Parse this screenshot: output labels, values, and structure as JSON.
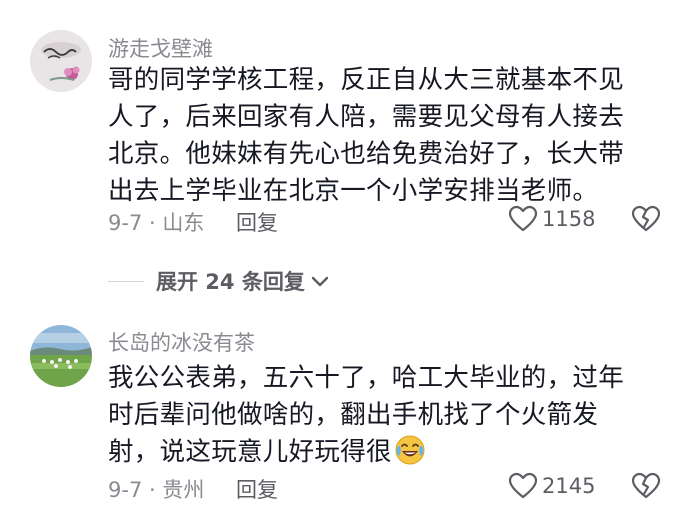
{
  "comments": [
    {
      "username": "游走戈壁滩",
      "lines": [
        "哥的同学学核工程，反正自从大三就基本不见",
        "人了，后来回家有人陪，需要见父母有人接去",
        "北京。他妹妹有先心也给免费治好了，长大带",
        "出去上学毕业在北京一个小学安排当老师。"
      ],
      "meta": "9-7 · 山东",
      "reply_label": "回复",
      "likes": "1158",
      "avatar_icon": "calligraphy-flower-avatar"
    },
    {
      "username": "长岛的冰没有茶",
      "lines": [
        "我公公表弟，五六十了，哈工大毕业的，过年",
        "时后辈问他做啥的，翻出手机找了个火箭发",
        "射，说这玩意儿好玩得很"
      ],
      "meta": "9-7 · 贵州",
      "reply_label": "回复",
      "likes": "2145",
      "avatar_icon": "grassland-sheep-avatar",
      "trailing_emoji": "laugh-cry-emoji"
    }
  ],
  "expand_replies": {
    "label": "展开 24 条回复"
  },
  "colors": {
    "text": "#161823",
    "secondary": "#8a8b91",
    "action": "#5c5d63"
  }
}
